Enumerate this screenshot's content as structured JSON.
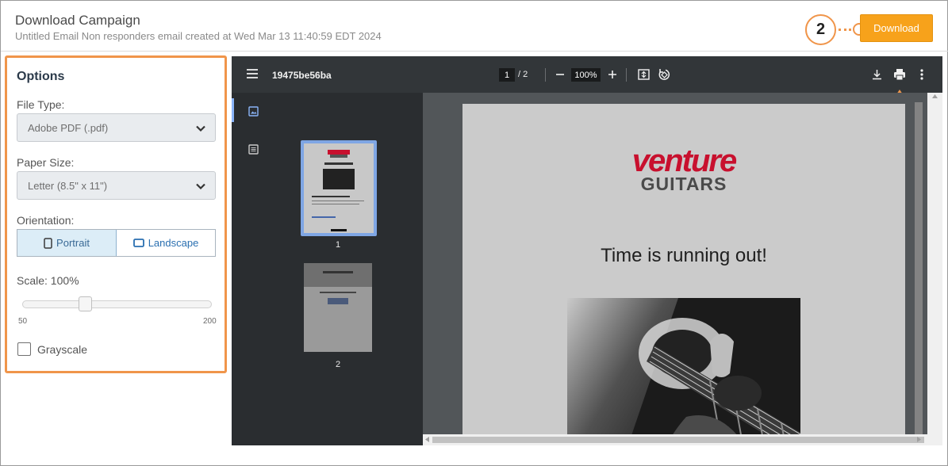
{
  "header": {
    "title": "Download Campaign",
    "subtitle": "Untitled Email Non responders email created at Wed Mar 13 11:40:59 EDT 2024",
    "download_label": "Download",
    "step_badge": "2"
  },
  "options": {
    "title": "Options",
    "file_type_label": "File Type:",
    "file_type_value": "Adobe PDF (.pdf)",
    "paper_size_label": "Paper Size:",
    "paper_size_value": "Letter (8.5\" x 11\")",
    "orientation_label": "Orientation:",
    "orientation_options": [
      "Portrait",
      "Landscape"
    ],
    "orientation_selected": "Portrait",
    "scale_label": "Scale: 100%",
    "scale_value": 100,
    "scale_min": "50",
    "scale_max": "200",
    "grayscale_label": "Grayscale",
    "grayscale_checked": false
  },
  "viewer": {
    "file_name": "19475be56ba",
    "current_page": "1",
    "page_count": "/ 2",
    "zoom": "100%",
    "thumbnails": [
      {
        "label": "1"
      },
      {
        "label": "2"
      }
    ],
    "page": {
      "brand_top": "venture",
      "brand_bottom": "GUITARS",
      "heading": "Time is running out!"
    }
  },
  "colors": {
    "accent": "#f7a21b",
    "highlight": "#f0954a",
    "viewer_bg": "#333639",
    "brand_red": "#c8102e"
  }
}
